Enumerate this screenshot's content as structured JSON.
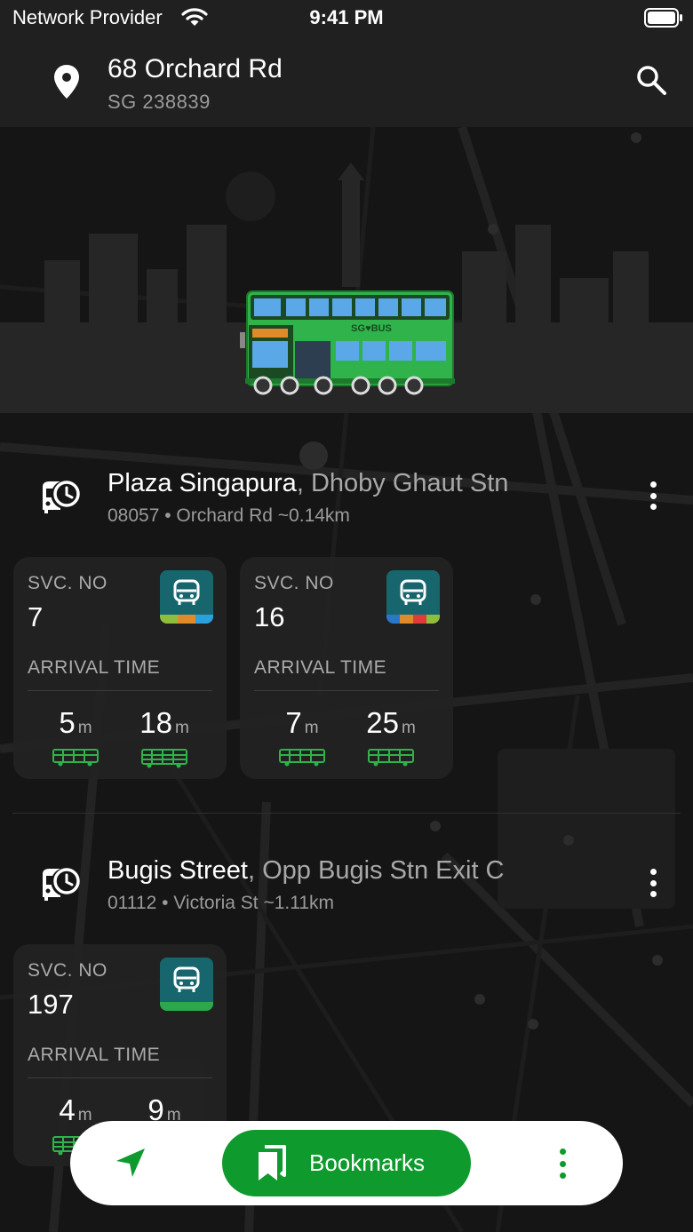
{
  "status_bar": {
    "carrier": "Network Provider",
    "time": "9:41 PM",
    "wifi_icon": "wifi-icon",
    "battery_icon": "battery-icon"
  },
  "header": {
    "address": "68 Orchard Rd",
    "postal": "SG 238839",
    "location_icon": "map-pin-icon",
    "search_icon": "search-icon"
  },
  "hero": {
    "illustration": "double-decker-bus-illustration",
    "bus_text": "SG♥BUS"
  },
  "stops": [
    {
      "name": "Plaza Singapura",
      "name_suffix": ", Dhoby Ghaut Stn",
      "meta": "08057 • Orchard Rd ~0.14km",
      "services": [
        {
          "label": "SVC. NO",
          "number": "7",
          "arrival_label": "ARRIVAL TIME",
          "times": [
            {
              "value": "5",
              "unit": "m"
            },
            {
              "value": "18",
              "unit": "m"
            }
          ],
          "badge_colors": [
            "#8fbe3c",
            "#e08a28",
            "#2aa0dc"
          ]
        },
        {
          "label": "SVC. NO",
          "number": "16",
          "arrival_label": "ARRIVAL TIME",
          "times": [
            {
              "value": "7",
              "unit": "m"
            },
            {
              "value": "25",
              "unit": "m"
            }
          ],
          "badge_colors": [
            "#2a76c9",
            "#e08a28",
            "#e03b3b",
            "#8fbe3c"
          ]
        }
      ]
    },
    {
      "name": "Bugis Street",
      "name_suffix": ", Opp Bugis Stn Exit C",
      "meta": "01112 • Victoria St ~1.11km",
      "services": [
        {
          "label": "SVC. NO",
          "number": "197",
          "arrival_label": "ARRIVAL TIME",
          "times": [
            {
              "value": "4",
              "unit": "m"
            },
            {
              "value": "9",
              "unit": "m"
            }
          ],
          "badge_colors": [
            "#2aa84a"
          ]
        }
      ]
    }
  ],
  "bottom_bar": {
    "navigation_icon": "navigation-arrow-icon",
    "bookmarks_label": "Bookmarks",
    "more_icon": "more-vertical-icon"
  },
  "colors": {
    "accent": "#0f9a2e",
    "bus_green": "#2fb34a",
    "background": "#161616",
    "card": "#222222"
  }
}
